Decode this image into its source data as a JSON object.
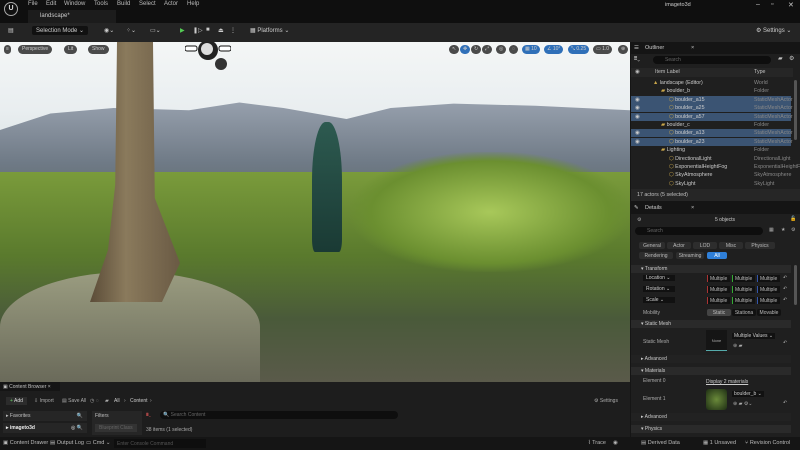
{
  "app": {
    "project_name": "imageto3d",
    "document_tab": "landscape*"
  },
  "menu": [
    "File",
    "Edit",
    "Window",
    "Tools",
    "Build",
    "Select",
    "Actor",
    "Help"
  ],
  "toolbar": {
    "selection_mode": "Selection Mode",
    "platforms": "Platforms",
    "settings": "Settings"
  },
  "viewport": {
    "buttons": [
      "Perspective",
      "Lit",
      "Show"
    ],
    "grid_snap": "10",
    "rotation_snap": "10°",
    "scale_snap": "0.25",
    "camera_speed": "1.0"
  },
  "outliner": {
    "title": "Outliner",
    "search_placeholder": "Search",
    "col_label": "Item Label",
    "col_type": "Type",
    "rows": [
      {
        "label": "landscape (Editor)",
        "type": "World",
        "indent": 1,
        "selected": false
      },
      {
        "label": "boulder_b",
        "type": "Folder",
        "indent": 2,
        "selected": false
      },
      {
        "label": "boulder_a15",
        "type": "StaticMeshActor",
        "indent": 3,
        "selected": true
      },
      {
        "label": "boulder_a25",
        "type": "StaticMeshActor",
        "indent": 3,
        "selected": true
      },
      {
        "label": "boulder_a57",
        "type": "StaticMeshActor",
        "indent": 3,
        "selected": true
      },
      {
        "label": "boulder_c",
        "type": "Folder",
        "indent": 2,
        "selected": false
      },
      {
        "label": "boulder_a13",
        "type": "StaticMeshActor",
        "indent": 3,
        "selected": true
      },
      {
        "label": "boulder_a23",
        "type": "StaticMeshActor",
        "indent": 3,
        "selected": true
      },
      {
        "label": "Lighting",
        "type": "Folder",
        "indent": 2,
        "selected": false
      },
      {
        "label": "DirectionalLight",
        "type": "DirectionalLight",
        "indent": 3,
        "selected": false
      },
      {
        "label": "ExponentialHeightFog",
        "type": "ExponentialHeightFog",
        "indent": 3,
        "selected": false
      },
      {
        "label": "SkyAtmosphere",
        "type": "SkyAtmosphere",
        "indent": 3,
        "selected": false
      },
      {
        "label": "SkyLight",
        "type": "SkyLight",
        "indent": 3,
        "selected": false
      }
    ],
    "footer": "17 actors (5 selected)"
  },
  "details": {
    "title": "Details",
    "objects": "5 objects",
    "search_placeholder": "Search",
    "filters": [
      "General",
      "Actor",
      "LOD",
      "Misc",
      "Physics",
      "Rendering",
      "Streaming",
      "All"
    ],
    "active_filter": "All",
    "transform": "Transform",
    "location": "Location",
    "rotation": "Rotation",
    "scale": "Scale",
    "multiple": "Multiple",
    "mobility": "Mobility",
    "mobility_options": [
      "Static",
      "Stationa",
      "Movable"
    ],
    "static_mesh_section": "Static Mesh",
    "static_mesh": "Static Mesh",
    "mesh_value": "Multiple Values",
    "mesh_thumb": "None",
    "advanced": "Advanced",
    "materials": "Materials",
    "element0": "Element 0",
    "display_materials": "Display 2 materials",
    "element1": "Element 1",
    "material_value": "boulder_b",
    "physics": "Physics"
  },
  "content_browser": {
    "title": "Content Browser",
    "add": "Add",
    "import": "Import",
    "save_all": "Save All",
    "path": [
      "All",
      "Content"
    ],
    "settings": "Settings",
    "favorites": "Favorites",
    "project": "imageto3d",
    "filters": "Filters",
    "class_filter": "Blueprint Class",
    "search_placeholder": "Search Content",
    "count": "38 items (1 selected)"
  },
  "statusbar": {
    "content_drawer": "Content Drawer",
    "output_log": "Output Log",
    "cmd": "Cmd",
    "console_placeholder": "Enter Console Command",
    "trace": "Trace",
    "derived_data": "Derived Data",
    "unsaved": "1 Unsaved",
    "revision_control": "Revision Control"
  }
}
